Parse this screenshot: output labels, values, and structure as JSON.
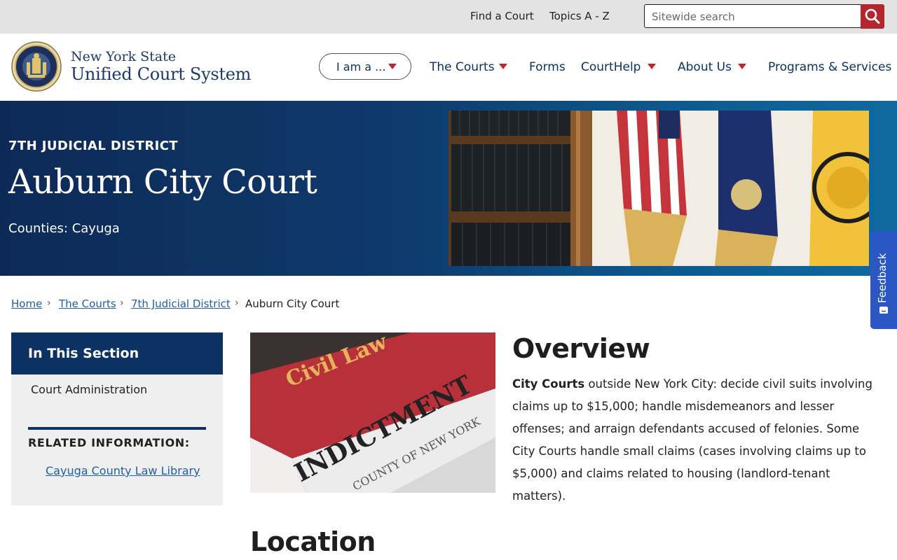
{
  "utility": {
    "links": [
      "Find a Court",
      "Topics A - Z"
    ],
    "search_placeholder": "Sitewide search",
    "search_icon": "search-icon"
  },
  "logo": {
    "line1": "New York State",
    "line2": "Unified Court System",
    "seal_icon": "nys-seal-icon"
  },
  "nav": {
    "iam_label": "I am a ...",
    "items": [
      "The Courts",
      "Forms",
      "CourtHelp",
      "About Us",
      "Programs & Services"
    ]
  },
  "hero": {
    "district": "7TH JUDICIAL DISTRICT",
    "title": "Auburn City Court",
    "counties": "Counties: Cayuga"
  },
  "feedback": {
    "label": "Feedback"
  },
  "breadcrumb": {
    "items": [
      "Home",
      "The Courts",
      "7th Judicial District"
    ],
    "current": "Auburn City Court"
  },
  "sidebar": {
    "title": "In This Section",
    "items": [
      "Court Administration"
    ],
    "related_title": "RELATED INFORMATION:",
    "related_link": "Cayuga County Law Library"
  },
  "content": {
    "overview_heading": "Overview",
    "overview_bold": "City Courts",
    "overview_body": " outside New York City: decide civil suits involving claims up to $15,000; handle misdemeanors and lesser offenses; and arraign defendants accused of felonies. Some City Courts handle small claims (cases involving claims up to $5,000) and claims related to housing (landlord-tenant matters).",
    "location_heading": "Location",
    "photo_texts": [
      "Civil Law",
      "INDICTMENT",
      "COUNTY OF NEW YORK"
    ]
  },
  "colors": {
    "navy": "#0b3262",
    "accent_red": "#b3262d",
    "link_blue": "#1f5fa8",
    "feedback_blue": "#2b57c3"
  }
}
